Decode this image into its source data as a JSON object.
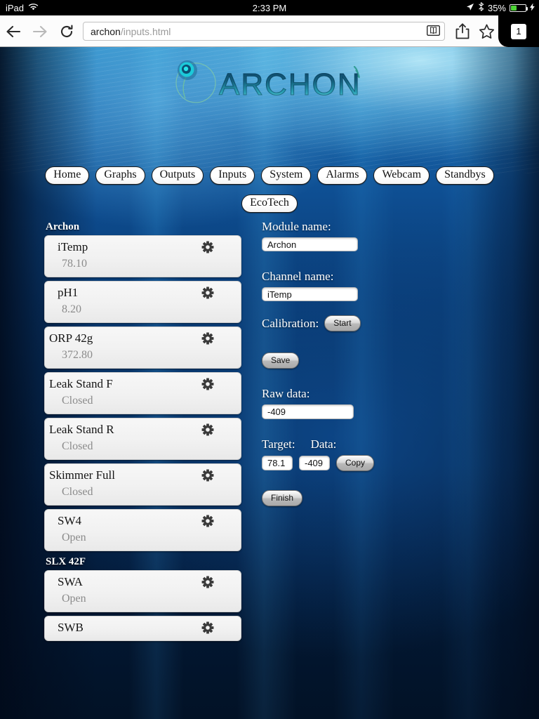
{
  "statusbar": {
    "device": "iPad",
    "wifi_icon": "wifi-icon",
    "time": "2:33 PM",
    "location_icon": "location-arrow-icon",
    "bluetooth_icon": "bluetooth-icon",
    "battery_percent": "35%",
    "battery_level": 35,
    "charging_icon": "lightning-bolt-icon"
  },
  "browser": {
    "back_icon": "back-arrow-icon",
    "forward_icon": "forward-arrow-icon",
    "reload_icon": "reload-icon",
    "url_host": "archon",
    "url_path": "/inputs.html",
    "reader_icon": "reader-view-icon",
    "share_icon": "share-icon",
    "bookmark_icon": "bookmark-star-icon",
    "tab_count": "1"
  },
  "logo": {
    "wordmark": "ARCHON",
    "mark_icon": "archon-swirl-icon",
    "signal_icon": "wifi-signal-icon"
  },
  "nav": {
    "row1": [
      {
        "label": "Home"
      },
      {
        "label": "Graphs"
      },
      {
        "label": "Outputs"
      },
      {
        "label": "Inputs"
      },
      {
        "label": "System"
      },
      {
        "label": "Alarms"
      },
      {
        "label": "Webcam"
      },
      {
        "label": "Standbys"
      }
    ],
    "row2": [
      {
        "label": "EcoTech"
      }
    ]
  },
  "list": {
    "groups": [
      {
        "header": "Archon",
        "items": [
          {
            "name": "iTemp",
            "value": "78.10",
            "indent": true,
            "gear_icon": "gear-icon"
          },
          {
            "name": "pH1",
            "value": "8.20",
            "indent": true,
            "gear_icon": "gear-icon"
          },
          {
            "name": "ORP 42g",
            "value": "372.80",
            "indent": false,
            "gear_icon": "gear-icon"
          },
          {
            "name": "Leak Stand F",
            "value": "Closed",
            "indent": false,
            "gear_icon": "gear-icon"
          },
          {
            "name": "Leak Stand R",
            "value": "Closed",
            "indent": false,
            "gear_icon": "gear-icon"
          },
          {
            "name": "Skimmer Full",
            "value": "Closed",
            "indent": false,
            "gear_icon": "gear-icon"
          },
          {
            "name": "SW4",
            "value": "Open",
            "indent": true,
            "gear_icon": "gear-icon"
          }
        ]
      },
      {
        "header": "SLX 42F",
        "items": [
          {
            "name": "SWA",
            "value": "Open",
            "indent": true,
            "gear_icon": "gear-icon"
          },
          {
            "name": "SWB",
            "value": "",
            "indent": true,
            "gear_icon": "gear-icon",
            "short": true
          }
        ]
      }
    ]
  },
  "form": {
    "module_label": "Module name:",
    "module_value": "Archon",
    "channel_label": "Channel name:",
    "channel_value": "iTemp",
    "calibration_label": "Calibration:",
    "start_button": "Start",
    "save_button": "Save",
    "raw_label": "Raw data:",
    "raw_value": "-409",
    "target_label": "Target:",
    "data_label": "Data:",
    "target_value": "78.1",
    "data_value": "-409",
    "copy_button": "Copy",
    "finish_button": "Finish"
  },
  "colors": {
    "water_top": "#2d8dc8",
    "water_bottom": "#03172f",
    "card_bg": "#f2f2f2",
    "value_text": "#8b8b8b",
    "battery_green": "#4cd435"
  }
}
